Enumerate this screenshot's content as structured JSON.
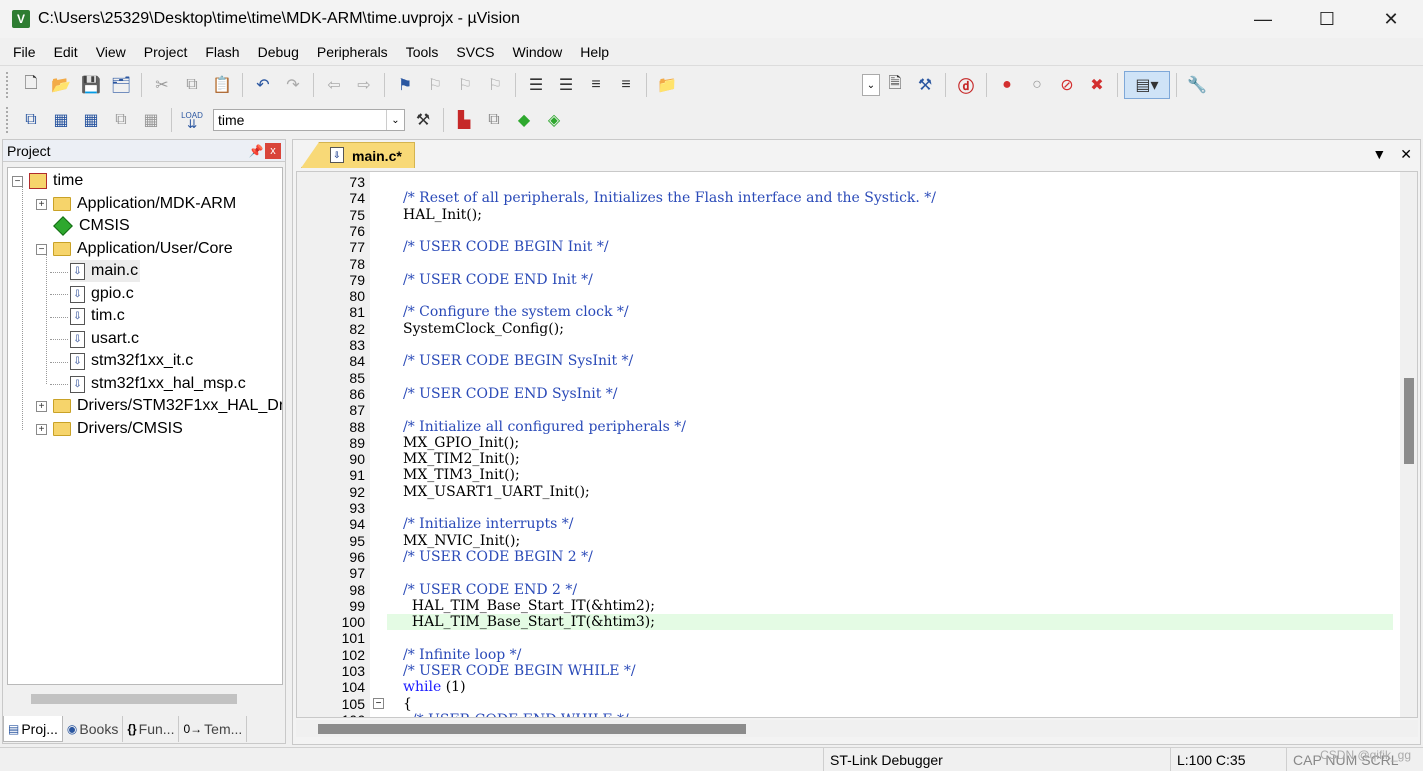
{
  "window": {
    "title": "C:\\Users\\25329\\Desktop\\time\\time\\MDK-ARM\\time.uvprojx - µVision",
    "app_icon_label": "V",
    "controls": [
      "—",
      "☐",
      "✕"
    ]
  },
  "menu": [
    "File",
    "Edit",
    "View",
    "Project",
    "Flash",
    "Debug",
    "Peripherals",
    "Tools",
    "SVCS",
    "Window",
    "Help"
  ],
  "toolbar2": {
    "target_label": "time",
    "load_label": "LOAD"
  },
  "project_panel": {
    "title": "Project",
    "pin": "📌",
    "close": "x",
    "tree": {
      "root": "time",
      "items": [
        {
          "label": "Application/MDK-ARM",
          "kind": "folder",
          "expander": "+"
        },
        {
          "label": "CMSIS",
          "kind": "gem",
          "expander": ""
        },
        {
          "label": "Application/User/Core",
          "kind": "folder",
          "expander": "−"
        },
        {
          "label": "main.c",
          "kind": "file",
          "expander": ""
        },
        {
          "label": "gpio.c",
          "kind": "file",
          "expander": ""
        },
        {
          "label": "tim.c",
          "kind": "file",
          "expander": ""
        },
        {
          "label": "usart.c",
          "kind": "file",
          "expander": ""
        },
        {
          "label": "stm32f1xx_it.c",
          "kind": "file",
          "expander": ""
        },
        {
          "label": "stm32f1xx_hal_msp.c",
          "kind": "file",
          "expander": ""
        },
        {
          "label": "Drivers/STM32F1xx_HAL_Dr",
          "kind": "folder",
          "expander": "+"
        },
        {
          "label": "Drivers/CMSIS",
          "kind": "folder",
          "expander": "+"
        }
      ]
    },
    "tabs": [
      {
        "icon": "▤",
        "label": "Proj..."
      },
      {
        "icon": "◉",
        "label": "Books"
      },
      {
        "icon": "{}",
        "label": "Fun..."
      },
      {
        "icon": "0→",
        "label": "Tem..."
      }
    ]
  },
  "editor": {
    "tab_label": "main.c*",
    "tab_menu": "▼",
    "tab_close": "✕",
    "lines": [
      {
        "n": "73",
        "text": "",
        "type": "code"
      },
      {
        "n": "74",
        "text": "/* Reset of all peripherals, Initializes the Flash interface and the Systick. */",
        "type": "comment"
      },
      {
        "n": "75",
        "text": "HAL_Init();",
        "type": "code"
      },
      {
        "n": "76",
        "text": "",
        "type": "code"
      },
      {
        "n": "77",
        "text": "/* USER CODE BEGIN Init */",
        "type": "comment"
      },
      {
        "n": "78",
        "text": "",
        "type": "code"
      },
      {
        "n": "79",
        "text": "/* USER CODE END Init */",
        "type": "comment"
      },
      {
        "n": "80",
        "text": "",
        "type": "code"
      },
      {
        "n": "81",
        "text": "/* Configure the system clock */",
        "type": "comment"
      },
      {
        "n": "82",
        "text": "SystemClock_Config();",
        "type": "code"
      },
      {
        "n": "83",
        "text": "",
        "type": "code"
      },
      {
        "n": "84",
        "text": "/* USER CODE BEGIN SysInit */",
        "type": "comment"
      },
      {
        "n": "85",
        "text": "",
        "type": "code"
      },
      {
        "n": "86",
        "text": "/* USER CODE END SysInit */",
        "type": "comment"
      },
      {
        "n": "87",
        "text": "",
        "type": "code"
      },
      {
        "n": "88",
        "text": "/* Initialize all configured peripherals */",
        "type": "comment"
      },
      {
        "n": "89",
        "text": "MX_GPIO_Init();",
        "type": "code"
      },
      {
        "n": "90",
        "text": "MX_TIM2_Init();",
        "type": "code"
      },
      {
        "n": "91",
        "text": "MX_TIM3_Init();",
        "type": "code"
      },
      {
        "n": "92",
        "text": "MX_USART1_UART_Init();",
        "type": "code"
      },
      {
        "n": "93",
        "text": "",
        "type": "code"
      },
      {
        "n": "94",
        "text": "/* Initialize interrupts */",
        "type": "comment"
      },
      {
        "n": "95",
        "text": "MX_NVIC_Init();",
        "type": "code"
      },
      {
        "n": "96",
        "text": "/* USER CODE BEGIN 2 */",
        "type": "comment"
      },
      {
        "n": "97",
        "text": "",
        "type": "code"
      },
      {
        "n": "98",
        "text": "/* USER CODE END 2 */",
        "type": "comment"
      },
      {
        "n": "99",
        "text": "  HAL_TIM_Base_Start_IT(&htim2);",
        "type": "code"
      },
      {
        "n": "100",
        "text": "  HAL_TIM_Base_Start_IT(&htim3);",
        "type": "code",
        "highlight": true
      },
      {
        "n": "101",
        "text": "",
        "type": "code"
      },
      {
        "n": "102",
        "text": "/* Infinite loop */",
        "type": "comment"
      },
      {
        "n": "103",
        "text": "/* USER CODE BEGIN WHILE */",
        "type": "comment"
      },
      {
        "n": "104",
        "text": "while (1)",
        "type": "keyword"
      },
      {
        "n": "105",
        "text": "{",
        "type": "code",
        "fold": "−"
      },
      {
        "n": "106",
        "text": "  /* USER CODE END WHILE */",
        "type": "comment"
      }
    ]
  },
  "statusbar": {
    "debugger": "ST-Link Debugger",
    "cursor": "L:100 C:35",
    "keys": "CAP  NUM  SCRL",
    "watermark": "CSDN @qifik_gg"
  },
  "colors": {
    "comment": "#2a4ab8",
    "keyword": "#1a1aff",
    "current_line": "#e4fbe4",
    "active_tab": "#f8d977"
  }
}
